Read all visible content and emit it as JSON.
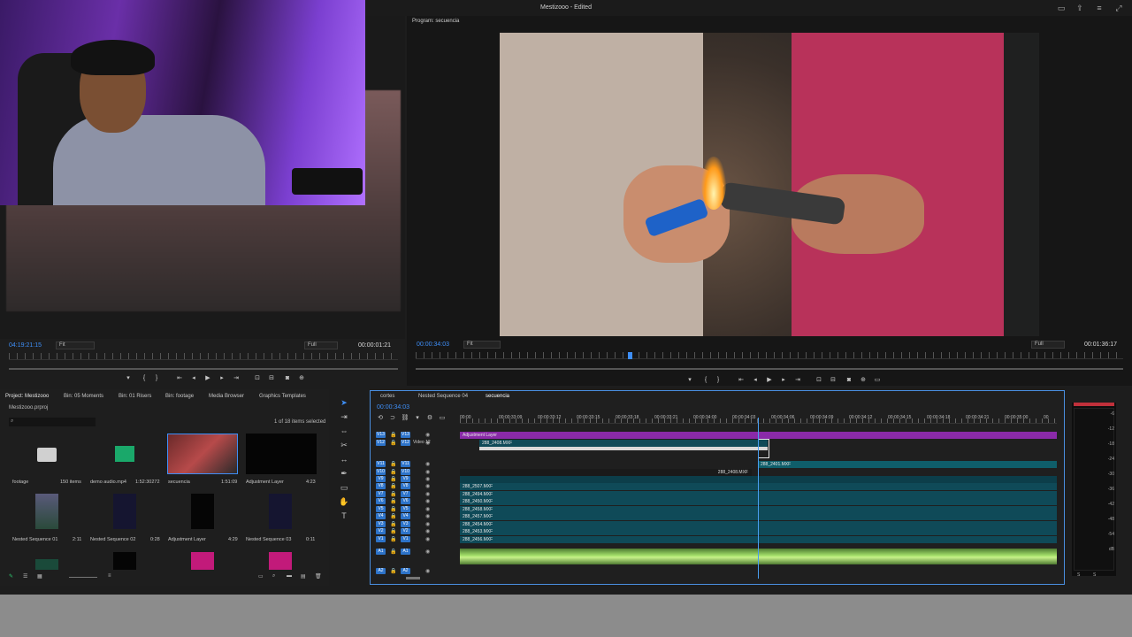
{
  "app": {
    "title": "Mestizooo - Edited"
  },
  "source_monitor": {
    "timecode": "04:19:21:15",
    "fit": "Fit",
    "full": "Full",
    "duration": "00:00:01:21"
  },
  "program_monitor": {
    "label": "Program: secuencia",
    "timecode": "00:00:34:03",
    "fit": "Fit",
    "full": "Full",
    "duration": "00:01:36:17"
  },
  "project": {
    "tabs": [
      "Project: Mestizooo",
      "Bin: 05 Moments",
      "Bin: 01 Risers",
      "Bin: footage",
      "Media Browser",
      "Graphics Templates"
    ],
    "path": "Mestizooo.prproj",
    "selected_count": "1 of 18 items selected",
    "items": [
      {
        "name": "footage",
        "info": "150 items"
      },
      {
        "name": "demo audio.mp4",
        "info": "1:52:30272"
      },
      {
        "name": "secuencia",
        "info": "1:51:09"
      },
      {
        "name": "Adjustment Layer",
        "info": "4:23"
      },
      {
        "name": "Nested Sequence 01",
        "info": "2:11"
      },
      {
        "name": "Nested Sequence 02",
        "info": "0:28"
      },
      {
        "name": "Adjustment Layer",
        "info": "4:29"
      },
      {
        "name": "Nested Sequence 03",
        "info": "0:11"
      }
    ]
  },
  "timeline": {
    "tabs": [
      "cortes",
      "Nested Sequence 04",
      "secuencia"
    ],
    "timecode": "00:00:34:03",
    "ruler": [
      "00:00",
      "00:00:33:09",
      "00:00:33:12",
      "00:00:33:15",
      "00:00:33:18",
      "00:00:33:21",
      "00:00:34:00",
      "00:00:34:03",
      "00:00:34:06",
      "00:00:34:09",
      "00:00:34:12",
      "00:00:34:15",
      "00:00:34:18",
      "00:00:34:21",
      "00:00:35:00",
      "00"
    ],
    "tracks": [
      {
        "id": "V13",
        "name": ""
      },
      {
        "id": "V12",
        "name": "Video 12"
      },
      {
        "id": "V11",
        "name": ""
      },
      {
        "id": "V10",
        "name": ""
      },
      {
        "id": "V9",
        "name": ""
      },
      {
        "id": "V8",
        "name": ""
      },
      {
        "id": "V7",
        "name": ""
      },
      {
        "id": "V6",
        "name": ""
      },
      {
        "id": "V5",
        "name": ""
      },
      {
        "id": "V4",
        "name": ""
      },
      {
        "id": "V3",
        "name": ""
      },
      {
        "id": "V2",
        "name": ""
      },
      {
        "id": "V1",
        "name": ""
      },
      {
        "id": "A1",
        "name": ""
      },
      {
        "id": "A2",
        "name": ""
      }
    ],
    "clips": {
      "adjustment": "Adjustment Layer",
      "c2408a": "288_2408.MXF",
      "c2401": "288_2401.MXF",
      "c2408b": "288_2408.MXF",
      "c2507": "288_2507.MXF",
      "c2494": "288_2494.MXF",
      "c2450": "288_2450.MXF",
      "c2458": "288_2458.MXF",
      "c2457": "288_2457.MXF",
      "c2454": "288_2454.MXF",
      "c2453": "288_2453.MXF",
      "c2456": "288_2456.MXF"
    }
  },
  "meter": {
    "levels": [
      "-6",
      "-12",
      "-18",
      "-24",
      "-30",
      "-36",
      "-42",
      "-48",
      "-54",
      "dB"
    ],
    "bottom": [
      "S",
      "S"
    ]
  }
}
